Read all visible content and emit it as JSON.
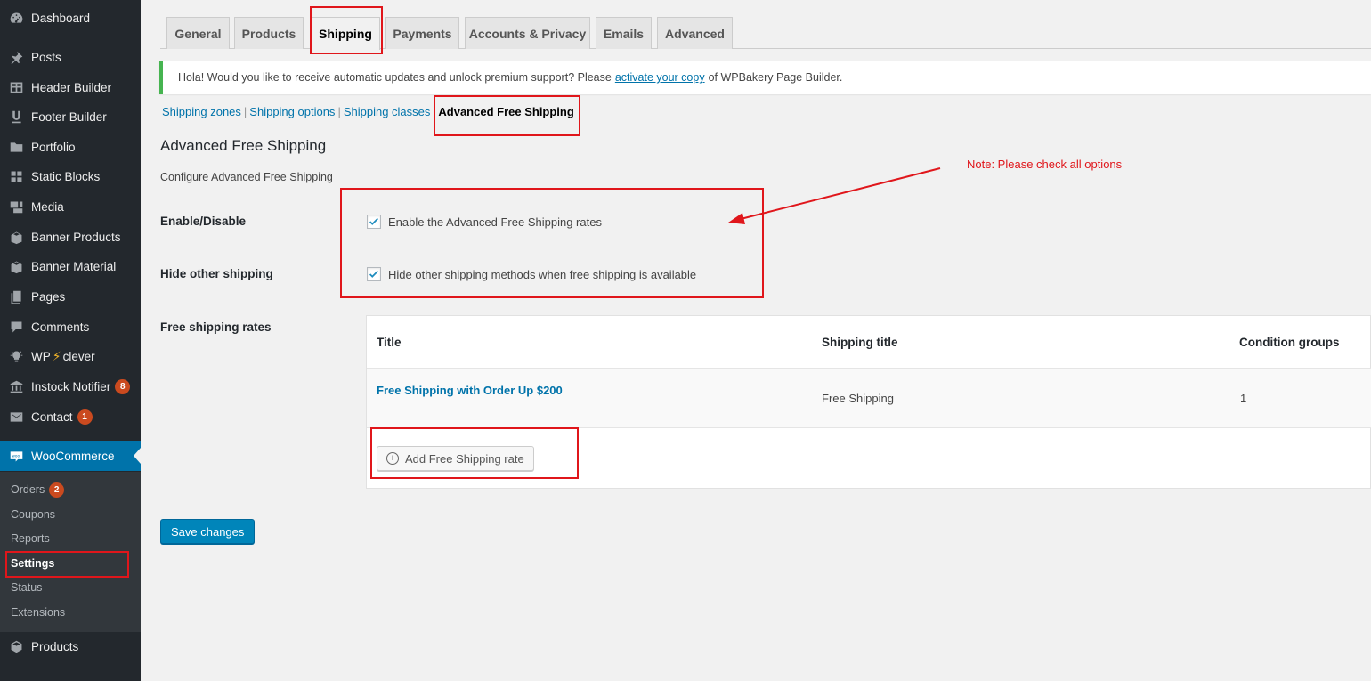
{
  "sidebar": {
    "items": [
      {
        "label": "Dashboard",
        "icon": "dashboard-icon"
      },
      {
        "label": "Posts",
        "icon": "pin-icon"
      },
      {
        "label": "Header Builder",
        "icon": "table-icon"
      },
      {
        "label": "Footer Builder",
        "icon": "underline-icon"
      },
      {
        "label": "Portfolio",
        "icon": "folder-icon"
      },
      {
        "label": "Static Blocks",
        "icon": "grid-icon"
      },
      {
        "label": "Media",
        "icon": "media-icon"
      },
      {
        "label": "Banner Products",
        "icon": "box-icon"
      },
      {
        "label": "Banner Material",
        "icon": "box-icon"
      },
      {
        "label": "Pages",
        "icon": "pages-icon"
      },
      {
        "label": "Comments",
        "icon": "comment-icon"
      },
      {
        "label": "WP",
        "label2": "clever",
        "icon": "lightbulb-icon"
      },
      {
        "label": "Instock Notifier",
        "icon": "bank-icon",
        "badge": "8"
      },
      {
        "label": "Contact",
        "icon": "mail-icon",
        "badge": "1"
      }
    ],
    "woocommerce": {
      "label": "WooCommerce",
      "icon": "woo-icon"
    },
    "submenu": [
      {
        "label": "Orders",
        "badge": "2"
      },
      {
        "label": "Coupons"
      },
      {
        "label": "Reports"
      },
      {
        "label": "Settings"
      },
      {
        "label": "Status"
      },
      {
        "label": "Extensions"
      }
    ],
    "products": {
      "label": "Products",
      "icon": "cube-icon"
    }
  },
  "tabs": [
    "General",
    "Products",
    "Shipping",
    "Payments",
    "Accounts & Privacy",
    "Emails",
    "Advanced"
  ],
  "notice": {
    "before": "Hola! Would you like to receive automatic updates and unlock premium support? Please",
    "link": "activate your copy",
    "after": "of WPBakery Page Builder."
  },
  "subnav": {
    "zones": "Shipping zones",
    "options": "Shipping options",
    "classes": "Shipping classes",
    "sep": "|",
    "current": "Advanced Free Shipping"
  },
  "section": {
    "title": "Advanced Free Shipping",
    "description": "Configure Advanced Free Shipping"
  },
  "fields": {
    "enable_label": "Enable/Disable",
    "enable_text": "Enable the Advanced Free Shipping rates",
    "hide_label": "Hide other shipping",
    "hide_text": "Hide other shipping methods when free shipping is available",
    "rates_label": "Free shipping rates"
  },
  "table": {
    "headers": [
      "Title",
      "Shipping title",
      "Condition groups"
    ],
    "row": {
      "title": "Free Shipping with Order Up $200",
      "shipping_title": "Free Shipping",
      "condition_groups": "1"
    },
    "add_button": "Add Free Shipping rate"
  },
  "save_label": "Save changes",
  "annotation": {
    "note": "Note: Please check all options",
    "color": "#e0161b"
  }
}
